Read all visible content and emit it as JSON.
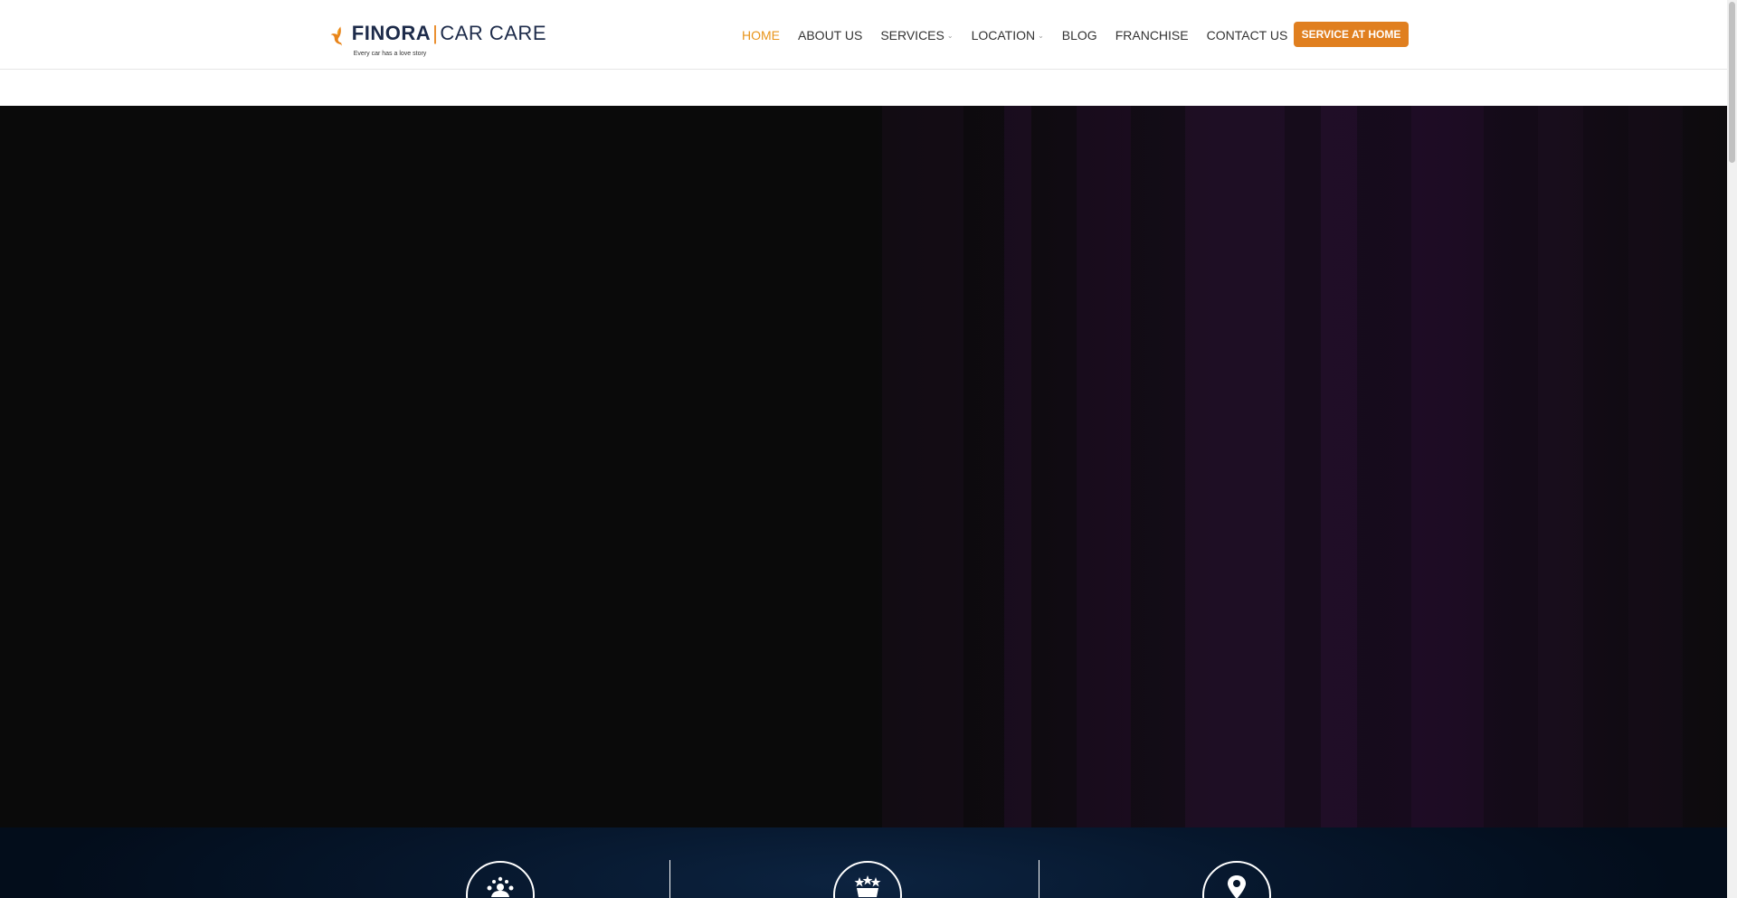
{
  "logo": {
    "brand": "FINORA",
    "separator": "|",
    "suffix": "CAR CARE",
    "tagline": "Every car has a love story",
    "icon": "bird-logo-icon",
    "accent_color": "#e8841a"
  },
  "nav": {
    "items": [
      {
        "label": "HOME",
        "active": true,
        "dropdown": false
      },
      {
        "label": "ABOUT US",
        "active": false,
        "dropdown": false
      },
      {
        "label": "SERVICES",
        "active": false,
        "dropdown": true
      },
      {
        "label": "LOCATION",
        "active": false,
        "dropdown": true
      },
      {
        "label": "BLOG",
        "active": false,
        "dropdown": false
      },
      {
        "label": "FRANCHISE",
        "active": false,
        "dropdown": false
      },
      {
        "label": "CONTACT US",
        "active": false,
        "dropdown": false
      }
    ],
    "caret_glyph": "⌄",
    "active_color": "#e8941a"
  },
  "cta": {
    "label": "SERVICE AT HOME",
    "color": "#e07f1f"
  },
  "features": {
    "icons": [
      "team-icon",
      "rating-badge-icon",
      "location-pin-icon"
    ]
  }
}
